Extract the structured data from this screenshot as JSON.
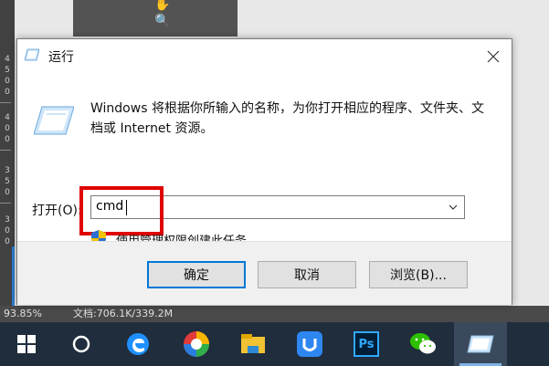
{
  "dialog": {
    "title": "运行",
    "description": "Windows 将根据你所输入的名称，为你打开相应的程序、文件夹、文档或 Internet 资源。",
    "open_label": "打开(O):",
    "command_value": "cmd",
    "admin_note": "使用管理权限创建此任务。",
    "buttons": {
      "ok": "确定",
      "cancel": "取消",
      "browse": "浏览(B)..."
    }
  },
  "background": {
    "zoom": "93.85%",
    "doc_info": "文档:706.1K/339.2M",
    "ruler_marks": [
      "4",
      "5",
      "0",
      "0",
      "4",
      "0",
      "0",
      "3",
      "5",
      "0",
      "3",
      "0",
      "0"
    ]
  },
  "taskbar": {
    "items": [
      "start-icon",
      "cortana-icon",
      "edge-icon",
      "photos-icon",
      "explorer-icon",
      "baidu-netdisk-icon",
      "photoshop-icon",
      "wechat-icon",
      "run-icon"
    ],
    "photoshop_label": "Ps"
  }
}
